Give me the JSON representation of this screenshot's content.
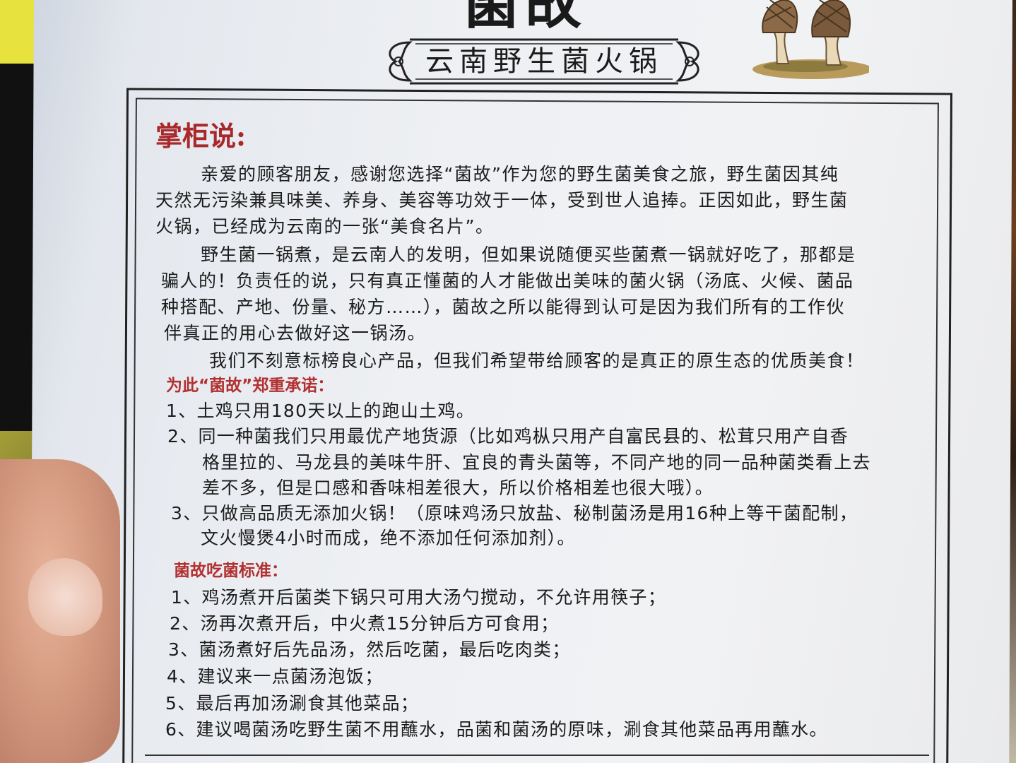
{
  "header": {
    "logo_text": "菌故",
    "banner_text": "云南野生菌火锅"
  },
  "section1": {
    "title": "掌柜说:",
    "p1_lines": [
      "亲爱的顾客朋友，感谢您选择“菌故”作为您的野生菌美食之旅，野生菌因其纯",
      "天然无污染兼具味美、养身、美容等功效于一体，受到世人追捧。正因如此，野生菌",
      "火锅，已经成为云南的一张“美食名片”。"
    ],
    "p2_lines": [
      "野生菌一锅煮，是云南人的发明，但如果说随便买些菌煮一锅就好吃了，那都是",
      "骗人的！负责任的说，只有真正懂菌的人才能做出美味的菌火锅（汤底、火候、菌品",
      "种搭配、产地、份量、秘方……），菌故之所以能得到认可是因为我们所有的工作伙",
      "伴真正的用心去做好这一锅汤。"
    ],
    "p3": "我们不刻意标榜良心产品，但我们希望带给顾客的是真正的原生态的优质美食！"
  },
  "section2": {
    "title": "为此“菌故”郑重承诺：",
    "items": [
      [
        "1、土鸡只用180天以上的跑山土鸡。"
      ],
      [
        "2、同一种菌我们只用最优产地货源（比如鸡枞只用产自富民县的、松茸只用产自香",
        "格里拉的、马龙县的美味牛肝、宜良的青头菌等，不同产地的同一品种菌类看上去",
        "差不多，但是口感和香味相差很大，所以价格相差也很大哦）。"
      ],
      [
        "3、只做高品质无添加火锅！（原味鸡汤只放盐、秘制菌汤是用16种上等干菌配制，",
        "文火慢煲4小时而成，绝不添加任何添加剂）。"
      ]
    ]
  },
  "section3": {
    "title": "菌故吃菌标准：",
    "items": [
      "1、鸡汤煮开后菌类下锅只可用大汤勺搅动，不允许用筷子；",
      "2、汤再次煮开后，中火煮15分钟后方可食用；",
      "3、菌汤煮好后先品汤，然后吃菌，最后吃肉类；",
      "4、建议来一点菌汤泡饭；",
      "5、最后再加汤涮食其他菜品；",
      "6、建议喝菌汤吃野生菌不用蘸水，品菌和菌汤的原味，涮食其他菜品再用蘸水。"
    ]
  },
  "colors": {
    "title_red": "#a8282b",
    "text": "#1c1c1c",
    "paper": "#eef0f3"
  }
}
